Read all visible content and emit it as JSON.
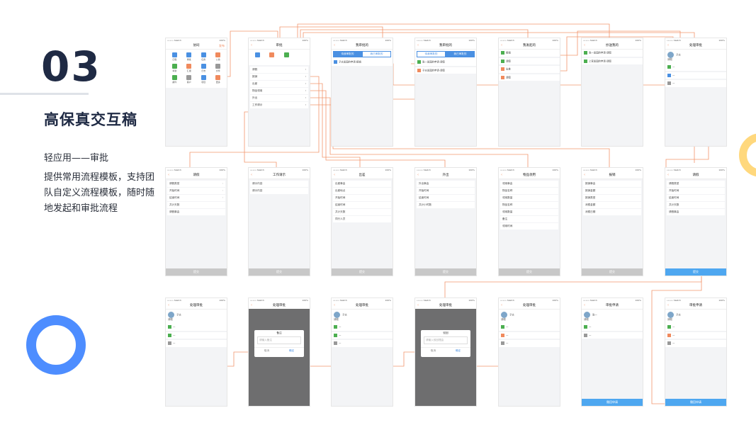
{
  "section": {
    "number": "03",
    "title": "高保真交互稿",
    "subtitle": "轻应用——审批",
    "description": "提供常用流程模板，支持团队自定义流程模板，随时随地发起和审批流程"
  },
  "colors": {
    "accent": "#f08a5d",
    "primary": "#1f2a44",
    "blue": "#4a90e2",
    "ring_blue": "#4d8dff",
    "ring_yellow": "#ffd166"
  },
  "phones": {
    "home": {
      "title": "协同",
      "action": "发布",
      "apps": [
        "日程",
        "审批",
        "任务",
        "公告",
        "考勤",
        "汇报",
        "日志",
        "文件",
        "邮件",
        "客户",
        "项目",
        "更多"
      ]
    },
    "approval_menu": {
      "title": "审批",
      "items": [
        "请假",
        "报销",
        "出差",
        "物品领用",
        "外出",
        "工作请示"
      ]
    },
    "my_approval": {
      "title": "我审批的",
      "tab_a": "待我审批的",
      "tab_b": "我已审批的",
      "item": "子夫发起的申请-报销"
    },
    "my_approval_done": {
      "title": "我审批的",
      "items": [
        "张一发起的申请-请假",
        "子夫发起的申请-请假"
      ]
    },
    "my_sent": {
      "title": "我发起的",
      "items": [
        "报销",
        "请假",
        "出差",
        "请假"
      ]
    },
    "cc_me": {
      "title": "抄送我的",
      "items": [
        "张一发起的申请-请假",
        "上官发起的申请-请假"
      ]
    },
    "detail_top": {
      "title": "处理审批",
      "name": "子夫",
      "type": "请假"
    },
    "leave": {
      "title": "请假",
      "fields": [
        "请假类型",
        "开始时间",
        "结束时间",
        "共计天数",
        "请假事由"
      ],
      "submit": "提交"
    },
    "work_request": {
      "title": "工作请示",
      "fields": [
        "请示内容",
        "请示内容"
      ],
      "submit": "提交"
    },
    "trip": {
      "title": "出差",
      "fields": [
        "出差事由",
        "出差地点",
        "开始时间",
        "结束时间",
        "共计天数",
        "同行人员"
      ],
      "submit": "提交"
    },
    "outing": {
      "title": "外出",
      "fields": [
        "外出事由",
        "开始时间",
        "结束时间",
        "共计小时数"
      ],
      "submit": "提交"
    },
    "goods": {
      "title": "物品领用",
      "fields": [
        "领用事由",
        "物品名称",
        "领用数量",
        "物品名称",
        "领用数量",
        "备注",
        "领用时间"
      ],
      "submit": "提交"
    },
    "expense": {
      "title": "报销",
      "fields": [
        "报销事由",
        "报销金额",
        "报销类型",
        "消费金额",
        "消费日期"
      ],
      "submit": "提交"
    },
    "leave_filled": {
      "title": "请假",
      "fields": [
        "请假类型",
        "开始时间",
        "结束时间",
        "共计天数",
        "请假事由"
      ],
      "submit": "提交"
    },
    "handle1": {
      "title": "处理审批",
      "name": "子夫",
      "type": "请假"
    },
    "handle_remark": {
      "title": "处理审批",
      "dialog_title": "备注",
      "placeholder": "请输入备注",
      "cancel": "取消",
      "ok": "确定"
    },
    "handle2": {
      "title": "处理审批",
      "name": "子夫",
      "type": "请假"
    },
    "handle_reject": {
      "title": "处理审批",
      "dialog_title": "驳回",
      "placeholder": "请输入驳回理由",
      "cancel": "取消",
      "ok": "确定"
    },
    "handle3": {
      "title": "处理审批",
      "name": "子夫",
      "type": "请假"
    },
    "apply1": {
      "title": "审批申请",
      "name": "张一",
      "type": "请假",
      "button": "撤回申请"
    },
    "apply2": {
      "title": "审批申请",
      "name": "子夫",
      "type": "请假",
      "button": "撤回申请"
    }
  }
}
